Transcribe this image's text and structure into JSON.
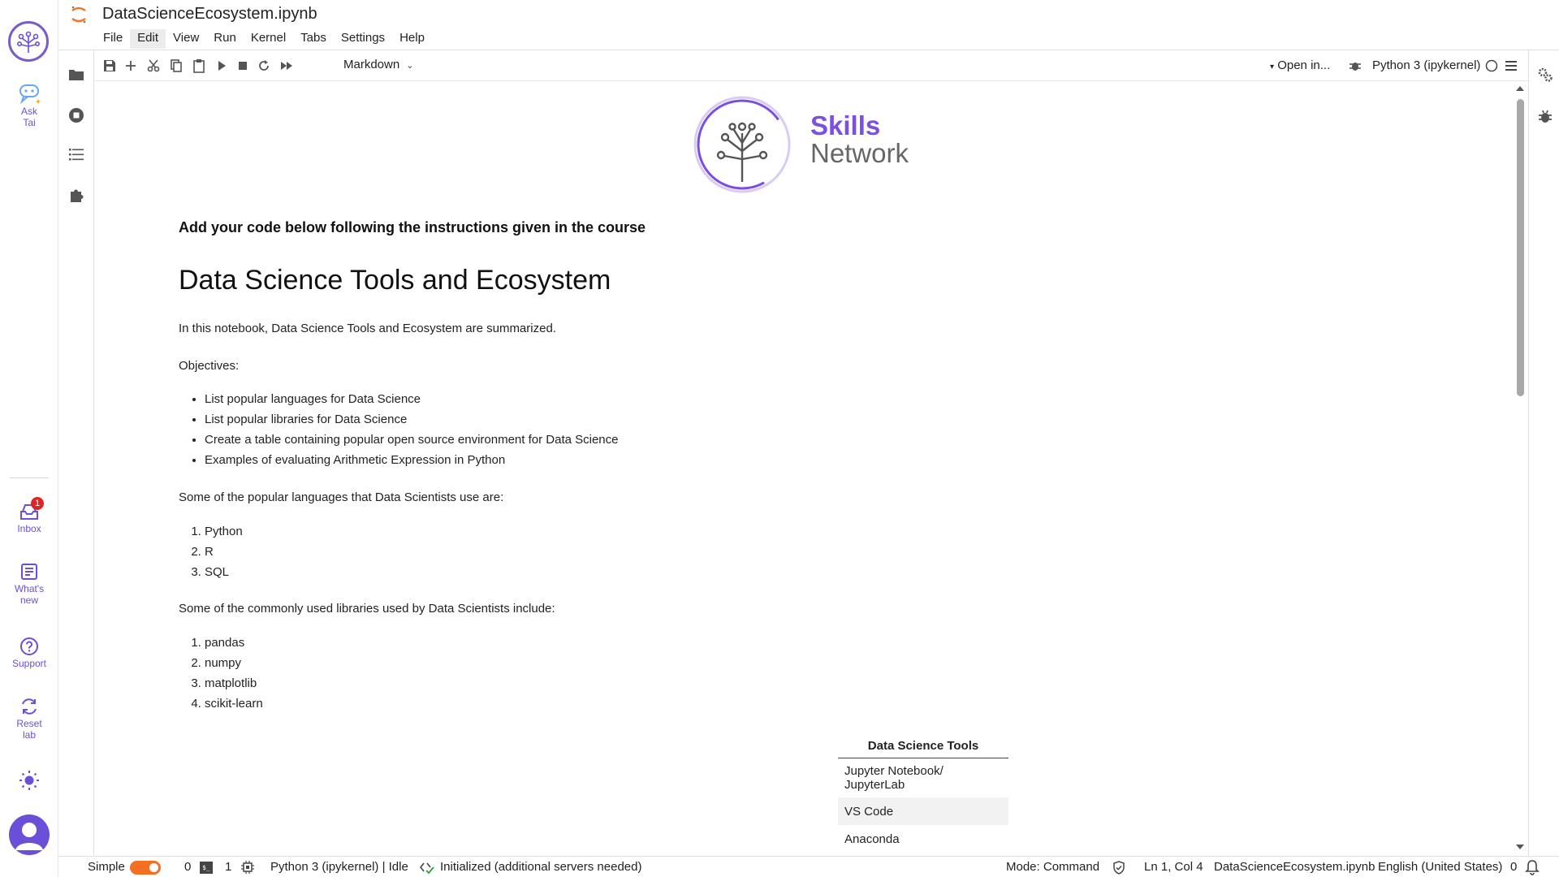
{
  "sn_rail": {
    "ask": "Ask\nTai",
    "ask_line1": "Ask",
    "ask_line2": "Tai",
    "inbox": "Inbox",
    "inbox_badge": "1",
    "whatsnew_line1": "What's",
    "whatsnew_line2": "new",
    "support": "Support",
    "reset_line1": "Reset",
    "reset_line2": "lab",
    "accent_color": "#6b4fd8"
  },
  "header": {
    "title": "DataScienceEcosystem.ipynb",
    "menu": [
      "File",
      "Edit",
      "View",
      "Run",
      "Kernel",
      "Tabs",
      "Settings",
      "Help"
    ],
    "active_menu": "Edit"
  },
  "toolbar": {
    "cell_type": "Markdown",
    "open_in": "Open in...",
    "kernel": "Python 3 (ipykernel)"
  },
  "notebook": {
    "banner_line1": "Skills",
    "banner_line2": "Network",
    "intro_heading": "Add your code below following the instructions given in the course",
    "title": "Data Science Tools and Ecosystem",
    "summary": "In this notebook, Data Science Tools and Ecosystem are summarized.",
    "objectives_label": "Objectives:",
    "objectives": [
      "List popular languages for Data Science",
      "List popular libraries for Data Science",
      "Create a table containing popular open source environment for Data Science",
      "Examples of evaluating Arithmetic Expression in Python"
    ],
    "languages_intro": "Some of the popular languages that Data Scientists use are:",
    "languages": [
      "Python",
      "R",
      "SQL"
    ],
    "libraries_intro": "Some of the commonly used libraries used by Data Scientists include:",
    "libraries": [
      "pandas",
      "numpy",
      "matplotlib",
      "scikit-learn"
    ],
    "table": {
      "header": "Data Science Tools",
      "rows": [
        "Jupyter Notebook/ JupyterLab",
        "VS Code",
        "Anaconda"
      ]
    }
  },
  "statusbar": {
    "mode_toggle": "Simple",
    "terminals": "0",
    "kernels": "1",
    "kernel_status": "Python 3 (ipykernel) | Idle",
    "lsp_status": "Initialized (additional servers needed)",
    "mode": "Mode: Command",
    "cursor": "Ln 1, Col 4",
    "file": "DataScienceEcosystem.ipynb",
    "language": "English (United States)",
    "notifications": "0",
    "toggle_color": "#f46f20"
  }
}
